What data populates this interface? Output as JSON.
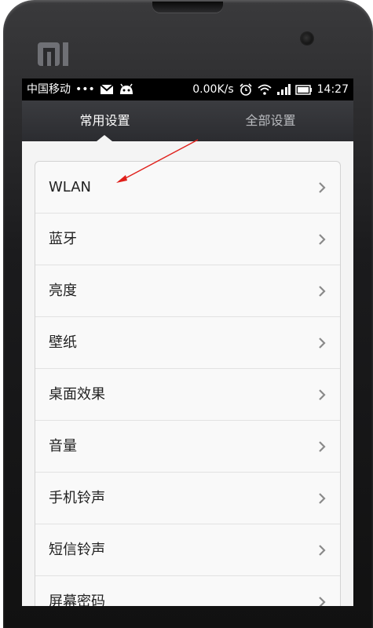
{
  "device": {
    "brand_logo": "mi-logo"
  },
  "status_bar": {
    "carrier": "中国移动",
    "dots": "•••",
    "speed": "0.00K/s",
    "time": "14:27",
    "icons": [
      "mail-icon",
      "android-icon",
      "alarm-icon",
      "wifi-icon",
      "signal-icon",
      "battery-icon"
    ]
  },
  "tabs": [
    {
      "label": "常用设置",
      "active": true
    },
    {
      "label": "全部设置",
      "active": false
    }
  ],
  "settings": {
    "items": [
      {
        "label": "WLAN"
      },
      {
        "label": "蓝牙"
      },
      {
        "label": "亮度"
      },
      {
        "label": "壁纸"
      },
      {
        "label": "桌面效果"
      },
      {
        "label": "音量"
      },
      {
        "label": "手机铃声"
      },
      {
        "label": "短信铃声"
      },
      {
        "label": "屏幕密码"
      }
    ]
  },
  "annotation": {
    "color": "#e0201b"
  }
}
